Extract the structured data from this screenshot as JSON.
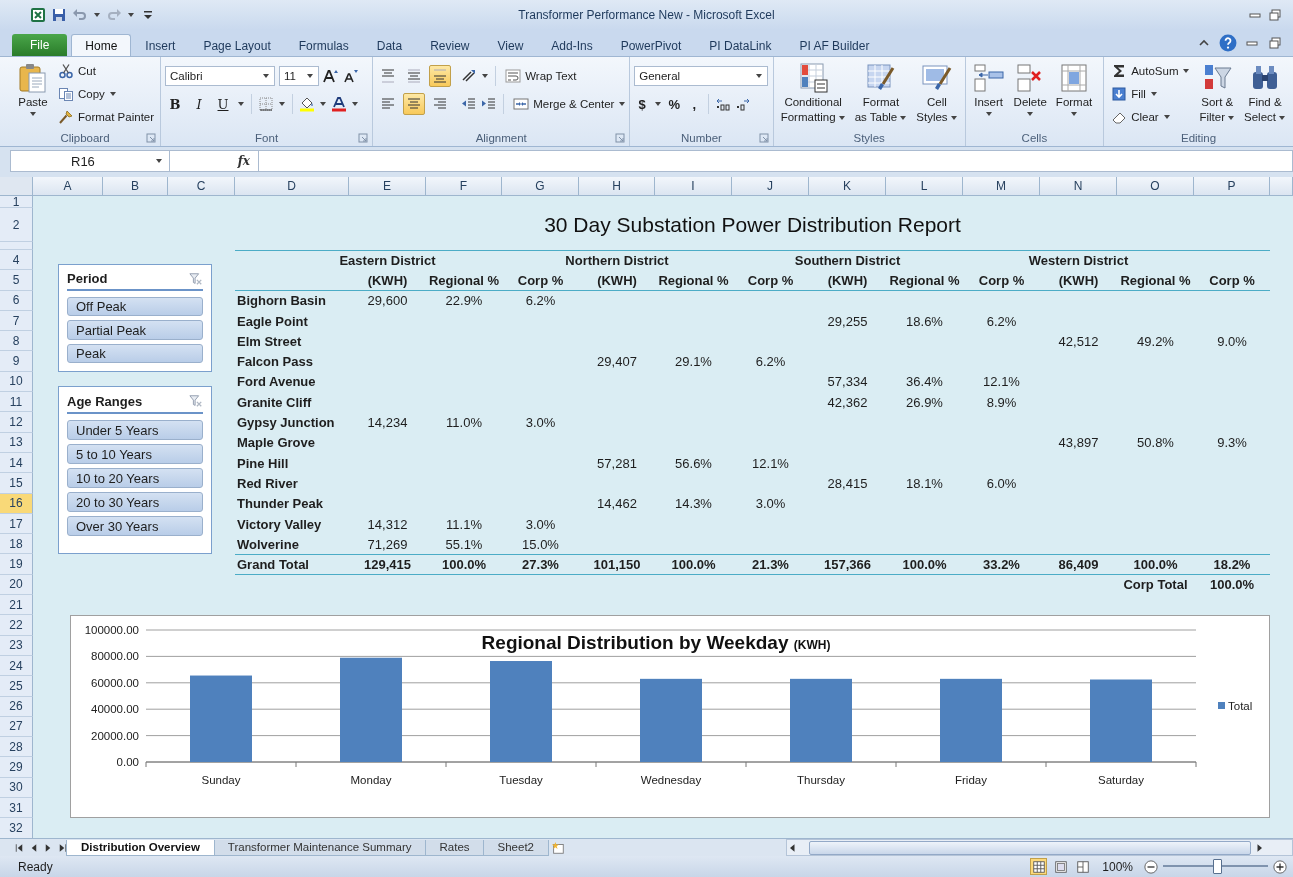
{
  "window": {
    "title": "Transformer Performance New  -  Microsoft Excel"
  },
  "ribbon_tabs": [
    {
      "label": "File",
      "kind": "file",
      "selected": false
    },
    {
      "label": "Home",
      "kind": "tab",
      "selected": true
    },
    {
      "label": "Insert",
      "kind": "tab",
      "selected": false
    },
    {
      "label": "Page Layout",
      "kind": "tab",
      "selected": false
    },
    {
      "label": "Formulas",
      "kind": "tab",
      "selected": false
    },
    {
      "label": "Data",
      "kind": "tab",
      "selected": false
    },
    {
      "label": "Review",
      "kind": "tab",
      "selected": false
    },
    {
      "label": "View",
      "kind": "tab",
      "selected": false
    },
    {
      "label": "Add-Ins",
      "kind": "tab",
      "selected": false
    },
    {
      "label": "PowerPivot",
      "kind": "tab",
      "selected": false
    },
    {
      "label": "PI DataLink",
      "kind": "tab",
      "selected": false
    },
    {
      "label": "PI AF Builder",
      "kind": "tab",
      "selected": false
    }
  ],
  "ribbon": {
    "clipboard": {
      "label": "Clipboard",
      "paste": "Paste",
      "items": [
        {
          "kind": "cut",
          "label": "Cut",
          "dropdown": false
        },
        {
          "kind": "copy",
          "label": "Copy",
          "dropdown": true
        },
        {
          "kind": "painter",
          "label": "Format Painter",
          "dropdown": false
        }
      ]
    },
    "font": {
      "label": "Font",
      "family": "Calibri",
      "size": "11",
      "styles": [
        {
          "kind": "bold",
          "label": "B",
          "on": false
        },
        {
          "kind": "italic",
          "label": "I",
          "on": false
        },
        {
          "kind": "underline",
          "label": "U",
          "on": false
        }
      ]
    },
    "alignment": {
      "label": "Alignment",
      "vertical": [
        {
          "kind": "top",
          "on": false
        },
        {
          "kind": "middle",
          "on": false
        },
        {
          "kind": "bottom",
          "on": true
        }
      ],
      "horizontal": [
        {
          "kind": "left",
          "on": false
        },
        {
          "kind": "center",
          "on": true
        },
        {
          "kind": "right",
          "on": false
        }
      ],
      "wrap": "Wrap Text",
      "merge": "Merge & Center"
    },
    "number": {
      "label": "Number",
      "format": "General",
      "symbols": [
        "$",
        "%",
        ","
      ]
    },
    "styles": {
      "label": "Styles",
      "items": [
        {
          "kind": "conditional",
          "lines": [
            "Conditional",
            "Formatting"
          ]
        },
        {
          "kind": "table",
          "lines": [
            "Format",
            "as Table"
          ]
        },
        {
          "kind": "cellstyles",
          "lines": [
            "Cell",
            "Styles"
          ]
        }
      ]
    },
    "cells": {
      "label": "Cells",
      "items": [
        {
          "kind": "insert",
          "label": "Insert"
        },
        {
          "kind": "delete",
          "label": "Delete"
        },
        {
          "kind": "format",
          "label": "Format"
        }
      ]
    },
    "editing": {
      "label": "Editing",
      "items": [
        {
          "kind": "autosum",
          "label": "AutoSum"
        },
        {
          "kind": "fill",
          "label": "Fill"
        },
        {
          "kind": "clear",
          "label": "Clear"
        }
      ],
      "big": [
        {
          "kind": "sort",
          "lines": [
            "Sort &",
            "Filter"
          ]
        },
        {
          "kind": "find",
          "lines": [
            "Find &",
            "Select"
          ]
        }
      ]
    }
  },
  "formula_bar": {
    "name_box": "R16",
    "fx": "fx"
  },
  "sheet": {
    "columns": [
      {
        "label": "A",
        "selected": false
      },
      {
        "label": "B",
        "selected": false
      },
      {
        "label": "C",
        "selected": false
      },
      {
        "label": "D",
        "selected": false
      },
      {
        "label": "E",
        "selected": false
      },
      {
        "label": "F",
        "selected": false
      },
      {
        "label": "G",
        "selected": false
      },
      {
        "label": "H",
        "selected": false
      },
      {
        "label": "I",
        "selected": false
      },
      {
        "label": "J",
        "selected": false
      },
      {
        "label": "K",
        "selected": false
      },
      {
        "label": "L",
        "selected": false
      },
      {
        "label": "M",
        "selected": false
      },
      {
        "label": "N",
        "selected": false
      },
      {
        "label": "O",
        "selected": false
      },
      {
        "label": "P",
        "selected": false
      }
    ],
    "rows": [
      {
        "label": "1",
        "selected": false
      },
      {
        "label": "2",
        "selected": false
      },
      {
        "label": "4",
        "selected": false
      },
      {
        "label": "5",
        "selected": false
      },
      {
        "label": "6",
        "selected": false
      },
      {
        "label": "7",
        "selected": false
      },
      {
        "label": "8",
        "selected": false
      },
      {
        "label": "9",
        "selected": false
      },
      {
        "label": "10",
        "selected": false
      },
      {
        "label": "11",
        "selected": false
      },
      {
        "label": "12",
        "selected": false
      },
      {
        "label": "13",
        "selected": false
      },
      {
        "label": "14",
        "selected": false
      },
      {
        "label": "15",
        "selected": false
      },
      {
        "label": "16",
        "selected": true
      },
      {
        "label": "17",
        "selected": false
      },
      {
        "label": "18",
        "selected": false
      },
      {
        "label": "19",
        "selected": false
      },
      {
        "label": "20",
        "selected": false
      },
      {
        "label": "21",
        "selected": false
      },
      {
        "label": "22",
        "selected": false
      },
      {
        "label": "23",
        "selected": false
      },
      {
        "label": "24",
        "selected": false
      },
      {
        "label": "25",
        "selected": false
      },
      {
        "label": "26",
        "selected": false
      },
      {
        "label": "27",
        "selected": false
      },
      {
        "label": "28",
        "selected": false
      },
      {
        "label": "29",
        "selected": false
      },
      {
        "label": "30",
        "selected": false
      },
      {
        "label": "31",
        "selected": false
      },
      {
        "label": "32",
        "selected": false
      }
    ]
  },
  "report": {
    "title": "30 Day Substation Power Distribution Report",
    "districts": [
      "Eastern District",
      "Northern District",
      "Southern District",
      "Western District"
    ],
    "subheaders": [
      "(KWH)",
      "Regional %",
      "Corp %",
      "(KWH)",
      "Regional %",
      "Corp %",
      "(KWH)",
      "Regional %",
      "Corp %",
      "(KWH)",
      "Regional %",
      "Corp %"
    ],
    "rows": [
      {
        "name": "Bighorn Basin",
        "eastern": [
          "29,600",
          "22.9%",
          "6.2%"
        ]
      },
      {
        "name": "Eagle Point",
        "southern": [
          "29,255",
          "18.6%",
          "6.2%"
        ]
      },
      {
        "name": "Elm Street",
        "western": [
          "42,512",
          "49.2%",
          "9.0%"
        ]
      },
      {
        "name": "Falcon Pass",
        "northern": [
          "29,407",
          "29.1%",
          "6.2%"
        ]
      },
      {
        "name": "Ford Avenue",
        "southern": [
          "57,334",
          "36.4%",
          "12.1%"
        ]
      },
      {
        "name": "Granite Cliff",
        "southern": [
          "42,362",
          "26.9%",
          "8.9%"
        ]
      },
      {
        "name": "Gypsy Junction",
        "eastern": [
          "14,234",
          "11.0%",
          "3.0%"
        ]
      },
      {
        "name": "Maple Grove",
        "western": [
          "43,897",
          "50.8%",
          "9.3%"
        ]
      },
      {
        "name": "Pine Hill",
        "northern": [
          "57,281",
          "56.6%",
          "12.1%"
        ]
      },
      {
        "name": "Red River",
        "southern": [
          "28,415",
          "18.1%",
          "6.0%"
        ]
      },
      {
        "name": "Thunder Peak",
        "northern": [
          "14,462",
          "14.3%",
          "3.0%"
        ]
      },
      {
        "name": "Victory Valley",
        "eastern": [
          "14,312",
          "11.1%",
          "3.0%"
        ]
      },
      {
        "name": "Wolverine",
        "eastern": [
          "71,269",
          "55.1%",
          "15.0%"
        ]
      }
    ],
    "total": {
      "name": "Grand Total",
      "values": [
        "129,415",
        "100.0%",
        "27.3%",
        "101,150",
        "100.0%",
        "21.3%",
        "157,366",
        "100.0%",
        "33.2%",
        "86,409",
        "100.0%",
        "18.2%"
      ]
    },
    "corp_total": {
      "label": "Corp Total",
      "value": "100.0%"
    }
  },
  "slicers": [
    {
      "title": "Period",
      "items": [
        {
          "label": "Off Peak",
          "selected": true
        },
        {
          "label": "Partial Peak",
          "selected": true
        },
        {
          "label": "Peak",
          "selected": true
        }
      ]
    },
    {
      "title": "Age Ranges",
      "items": [
        {
          "label": "Under 5 Years",
          "selected": true
        },
        {
          "label": "5 to 10 Years",
          "selected": true
        },
        {
          "label": "10 to 20 Years",
          "selected": true
        },
        {
          "label": "20 to 30 Years",
          "selected": true
        },
        {
          "label": "Over 30 Years",
          "selected": true
        }
      ]
    }
  ],
  "chart": {
    "unit": "(KWH)",
    "chart_data": {
      "type": "bar",
      "title": "Regional Distribution by Weekday",
      "categories": [
        "Sunday",
        "Monday",
        "Tuesday",
        "Wednesday",
        "Thursday",
        "Friday",
        "Saturday"
      ],
      "series": [
        {
          "name": "Total",
          "color": "#4f81bd",
          "values": [
            65500,
            79000,
            76500,
            63000,
            63000,
            63000,
            62500
          ]
        }
      ],
      "ylim": [
        0,
        100000
      ],
      "grid": true,
      "yticks": [
        {
          "value": 0,
          "label": "0.00"
        },
        {
          "value": 20000,
          "label": "20000.00"
        },
        {
          "value": 40000,
          "label": "40000.00"
        },
        {
          "value": 60000,
          "label": "60000.00"
        },
        {
          "value": 80000,
          "label": "80000.00"
        },
        {
          "value": 100000,
          "label": "100000.00"
        }
      ]
    }
  },
  "sheet_tabs": [
    {
      "label": "Distribution Overview",
      "selected": true
    },
    {
      "label": "Transformer Maintenance Summary",
      "selected": false
    },
    {
      "label": "Rates",
      "selected": false
    },
    {
      "label": "Sheet2",
      "selected": false
    }
  ],
  "status_bar": {
    "text": "Ready",
    "views": [
      {
        "kind": "normal",
        "selected": true
      },
      {
        "kind": "layout",
        "selected": false
      },
      {
        "kind": "pagebreak",
        "selected": false
      }
    ],
    "zoom": "100%",
    "level": 0.5
  }
}
